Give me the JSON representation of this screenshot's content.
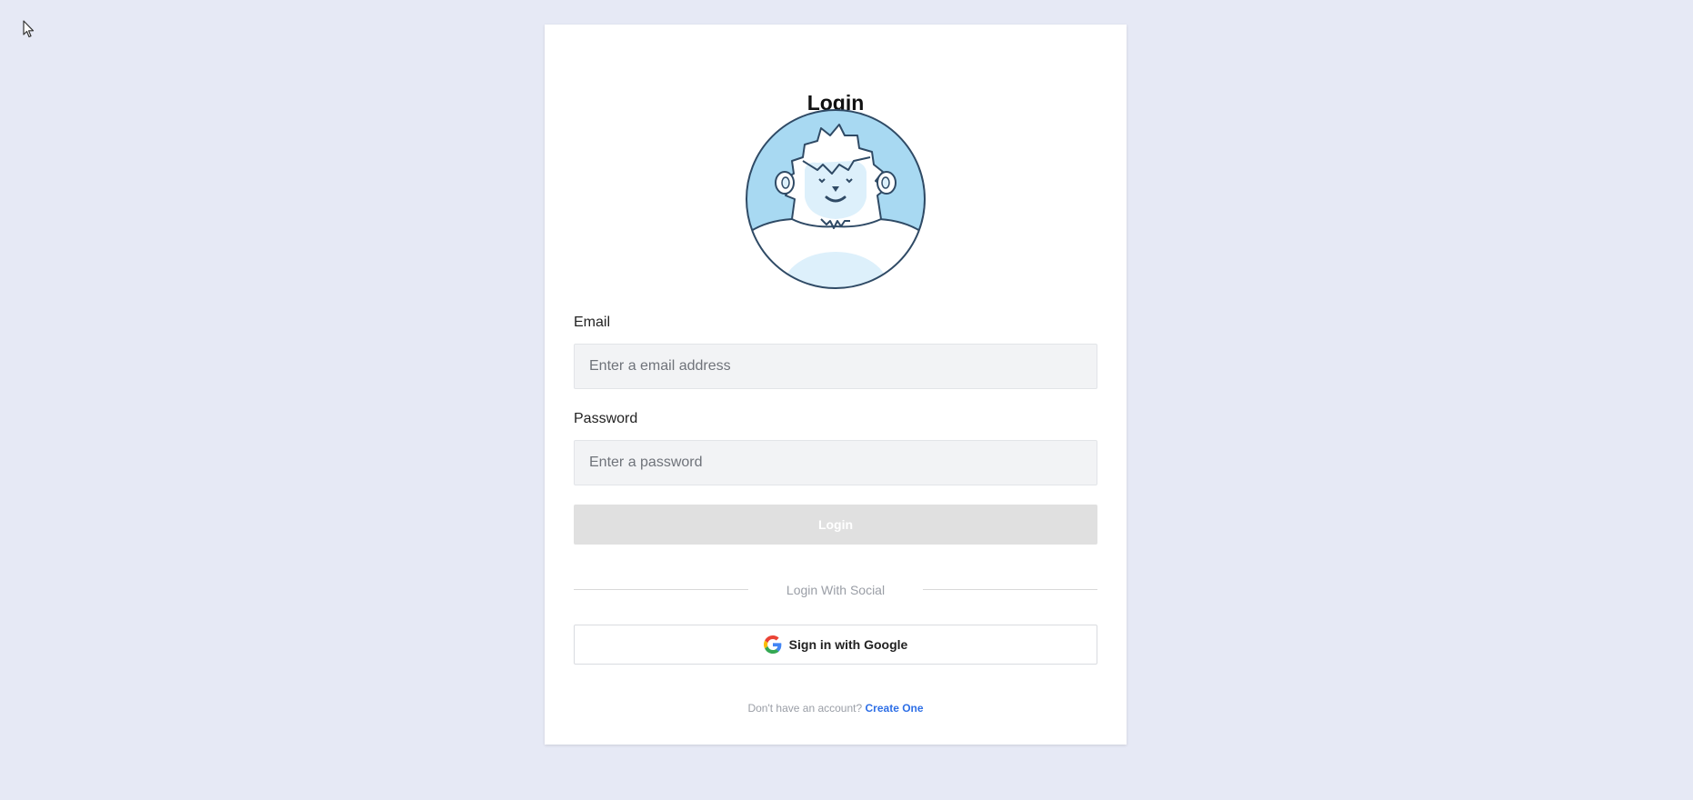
{
  "page": {
    "title": "Login"
  },
  "form": {
    "email_label": "Email",
    "email_placeholder": "Enter a email address",
    "email_value": "",
    "password_label": "Password",
    "password_placeholder": "Enter a password",
    "password_value": "",
    "login_button": "Login",
    "divider_text": "Login With Social",
    "google_button": "Sign in with Google"
  },
  "footer": {
    "prompt": "Don't have an account?",
    "link": "Create One"
  },
  "icons": {
    "cursor": "mouse-pointer-icon",
    "avatar": "yeti-avatar-icon",
    "google": "google-logo-icon"
  },
  "colors": {
    "background": "#e6e9f5",
    "card": "#ffffff",
    "login_button_disabled": "#e0e0e0",
    "link": "#2e6fe6",
    "avatar_bg": "#a8d9f2",
    "avatar_stroke": "#2f4a65"
  }
}
